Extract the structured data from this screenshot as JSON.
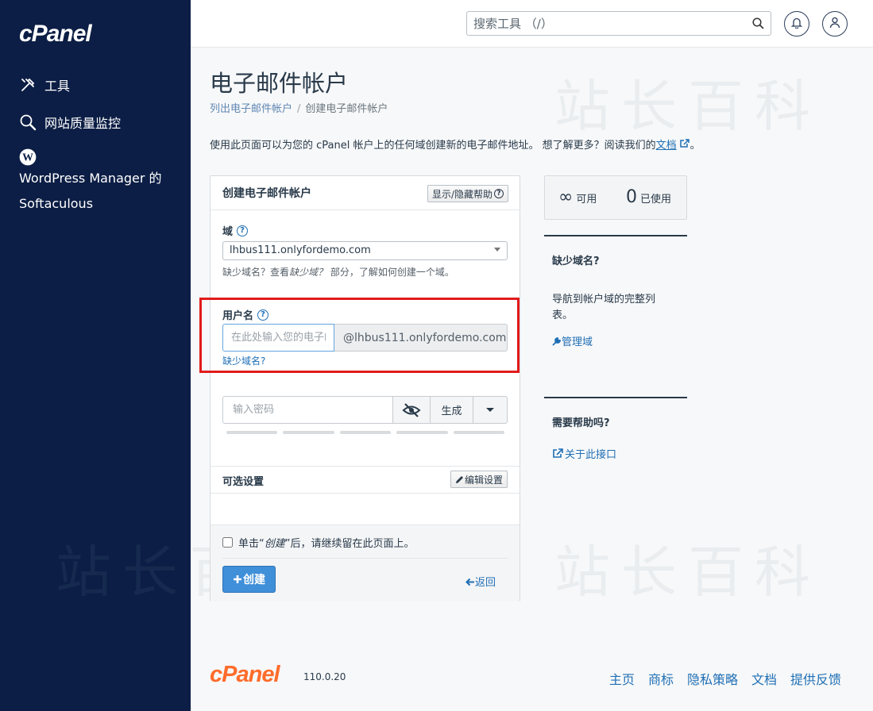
{
  "sidebar": {
    "logo": "cPanel",
    "items": [
      {
        "label": "工具",
        "icon": "tools-icon"
      },
      {
        "label": "网站质量监控",
        "icon": "magnifier-icon"
      },
      {
        "label": "WordPress Manager 的 Softaculous",
        "icon": "wordpress-icon"
      }
    ]
  },
  "header": {
    "search_placeholder": "搜索工具 （/）",
    "icons": [
      "search-icon",
      "bell-icon",
      "user-icon"
    ]
  },
  "watermark": "站长百科",
  "page": {
    "title": "电子邮件帐户",
    "breadcrumb": {
      "parent": "列出电子邮件帐户",
      "separator": "/",
      "current": "创建电子邮件帐户"
    },
    "intro_text": "使用此页面可以为您的 cPanel 帐户上的任何域创建新的电子邮件地址。 想了解更多？阅读我们的",
    "intro_link": "文档",
    "intro_end": "。"
  },
  "form": {
    "title": "创建电子邮件帐户",
    "help_toggle": "显示/隐藏帮助",
    "domain_label": "域",
    "domain_value": "lhbus111.onlyfordemo.com",
    "domain_hint_1": "缺少域名？查看",
    "domain_hint_em": "缺少域？",
    "domain_hint_2": "部分，了解如何创建一个域。",
    "username_label": "用户名",
    "username_placeholder": "在此处输入您的电子邮件地址",
    "username_addon": "@lhbus111.onlyfordemo.com",
    "missing_domain_link": "缺少域名?",
    "password_placeholder": "输入密码",
    "generate_label": "生成",
    "optional_title": "可选设置",
    "edit_settings": "编辑设置",
    "stay_prefix": "单击“",
    "stay_em": "创建",
    "stay_suffix": "”后，请继续留在此页面上。",
    "stay_checked": false,
    "create_label": "创建",
    "back_label": "返回"
  },
  "stats": {
    "available_value": "∞",
    "available_label": "可用",
    "used_value": "0",
    "used_label": "已使用"
  },
  "side": {
    "missing_title": "缺少域名?",
    "missing_text": "导航到帐户域的完整列表。",
    "manage_link": "管理域",
    "help_title": "需要帮助吗?",
    "about_link": "关于此接口"
  },
  "footer": {
    "logo": "cPanel",
    "version": "110.0.20",
    "links": [
      "主页",
      "商标",
      "隐私策略",
      "文档",
      "提供反馈"
    ]
  },
  "colors": {
    "sidebar": "#0c1e45",
    "accent": "#1f6fb5",
    "primary_button": "#3f8fd9",
    "footer_logo": "#ff6c2c",
    "highlight_box": "#e11b1b"
  }
}
